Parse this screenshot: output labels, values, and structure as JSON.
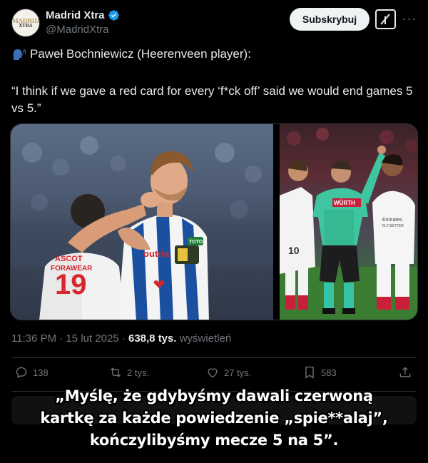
{
  "author": {
    "display_name": "Madrid Xtra",
    "handle": "@MadridXtra",
    "avatar_text_top": "MADRID",
    "avatar_text_bottom": "XTRA"
  },
  "header": {
    "subscribe_label": "Subskrybuj"
  },
  "tweet": {
    "line1": "Paweł Bochniewicz (Heerenveen player):",
    "line2": "“I think if we gave a red card for every ‘f*ck off’ said we would end games 5 vs 5.”"
  },
  "images": {
    "left": {
      "sponsor": "outria",
      "patch": "TOTO",
      "back_number": "19",
      "back_text_1": "ASCOT",
      "back_text_2": "FORAWEAR"
    },
    "right": {
      "referee_sponsor": "WÜRTH",
      "player_number": "10",
      "shirt_text": "Emirates",
      "shirt_text_2": "FLY BETTER"
    }
  },
  "meta": {
    "time": "11:36 PM · 15 lut 2025 · ",
    "views": "638,8 tys.",
    "views_label": " wyświetleń"
  },
  "actions": {
    "replies": "138",
    "reposts": "2 tys.",
    "likes": "27 tys.",
    "bookmarks": "583"
  },
  "caption": {
    "line1": "„Myślę, że gdybyśmy dawali czerwoną",
    "line2": "kartkę za każde powiedzenie „spie**alaj”,",
    "line3": "kończylibyśmy mecze 5 na 5”."
  },
  "colors": {
    "background": "#000000",
    "text": "#e7e9ea",
    "muted": "#71767b",
    "verified": "#1d9bf0",
    "heerenveen_blue": "#1b4fa0"
  }
}
